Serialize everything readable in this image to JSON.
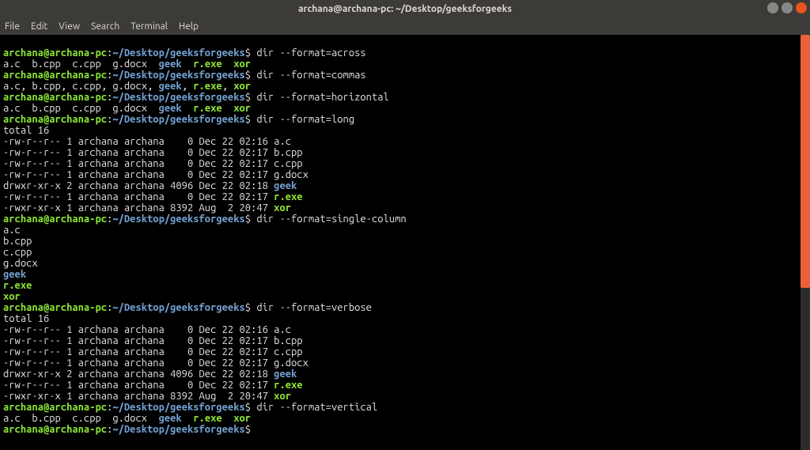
{
  "titlebar": {
    "text": "archana@archana-pc: ~/Desktop/geeksforgeeks"
  },
  "menubar": {
    "items": [
      "File",
      "Edit",
      "View",
      "Search",
      "Terminal",
      "Help"
    ]
  },
  "prompt": {
    "user": "archana@archana-pc",
    "colon": ":",
    "tilde": "~",
    "path": "/Desktop/geeksforgeeks",
    "dollar": "$"
  },
  "commands": {
    "across": "dir --format=across",
    "commas": "dir --format=commas",
    "horizontal": "dir --format=horizontal",
    "long": "dir --format=long",
    "single": "dir --format=single-column",
    "verbose": "dir --format=verbose",
    "vertical": "dir --format=vertical"
  },
  "outputs": {
    "across_row": {
      "f1": "a.c",
      "f2": "b.cpp",
      "f3": "c.cpp",
      "f4": "g.docx",
      "f5": "geek",
      "f6": "r.exe",
      "f7": "xor"
    },
    "commas_row": "a.c, b.cpp, c.cpp, g.docx, ",
    "commas_geek": "geek",
    "commas_mid": ", ",
    "commas_rexe": "r.exe",
    "commas_xor": "xor",
    "total": "total 16",
    "long": {
      "l1p": "-rw-r--r-- 1 archana archana    0 Dec 22 02:16 ",
      "l1f": "a.c",
      "l2p": "-rw-r--r-- 1 archana archana    0 Dec 22 02:17 ",
      "l2f": "b.cpp",
      "l3p": "-rw-r--r-- 1 archana archana    0 Dec 22 02:17 ",
      "l3f": "c.cpp",
      "l4p": "-rw-r--r-- 1 archana archana    0 Dec 22 02:17 ",
      "l4f": "g.docx",
      "l5p": "drwxr-xr-x 2 archana archana 4096 Dec 22 02:18 ",
      "l5f": "geek",
      "l6p": "-rw-r--r-- 1 archana archana    0 Dec 22 02:17 ",
      "l6f": "r.exe",
      "l7p": "-rwxr-xr-x 1 archana archana 8392 Aug  2 20:47 ",
      "l7f": "xor"
    },
    "single": {
      "s1": "a.c",
      "s2": "b.cpp",
      "s3": "c.cpp",
      "s4": "g.docx",
      "s5": "geek",
      "s6": "r.exe",
      "s7": "xor"
    }
  }
}
